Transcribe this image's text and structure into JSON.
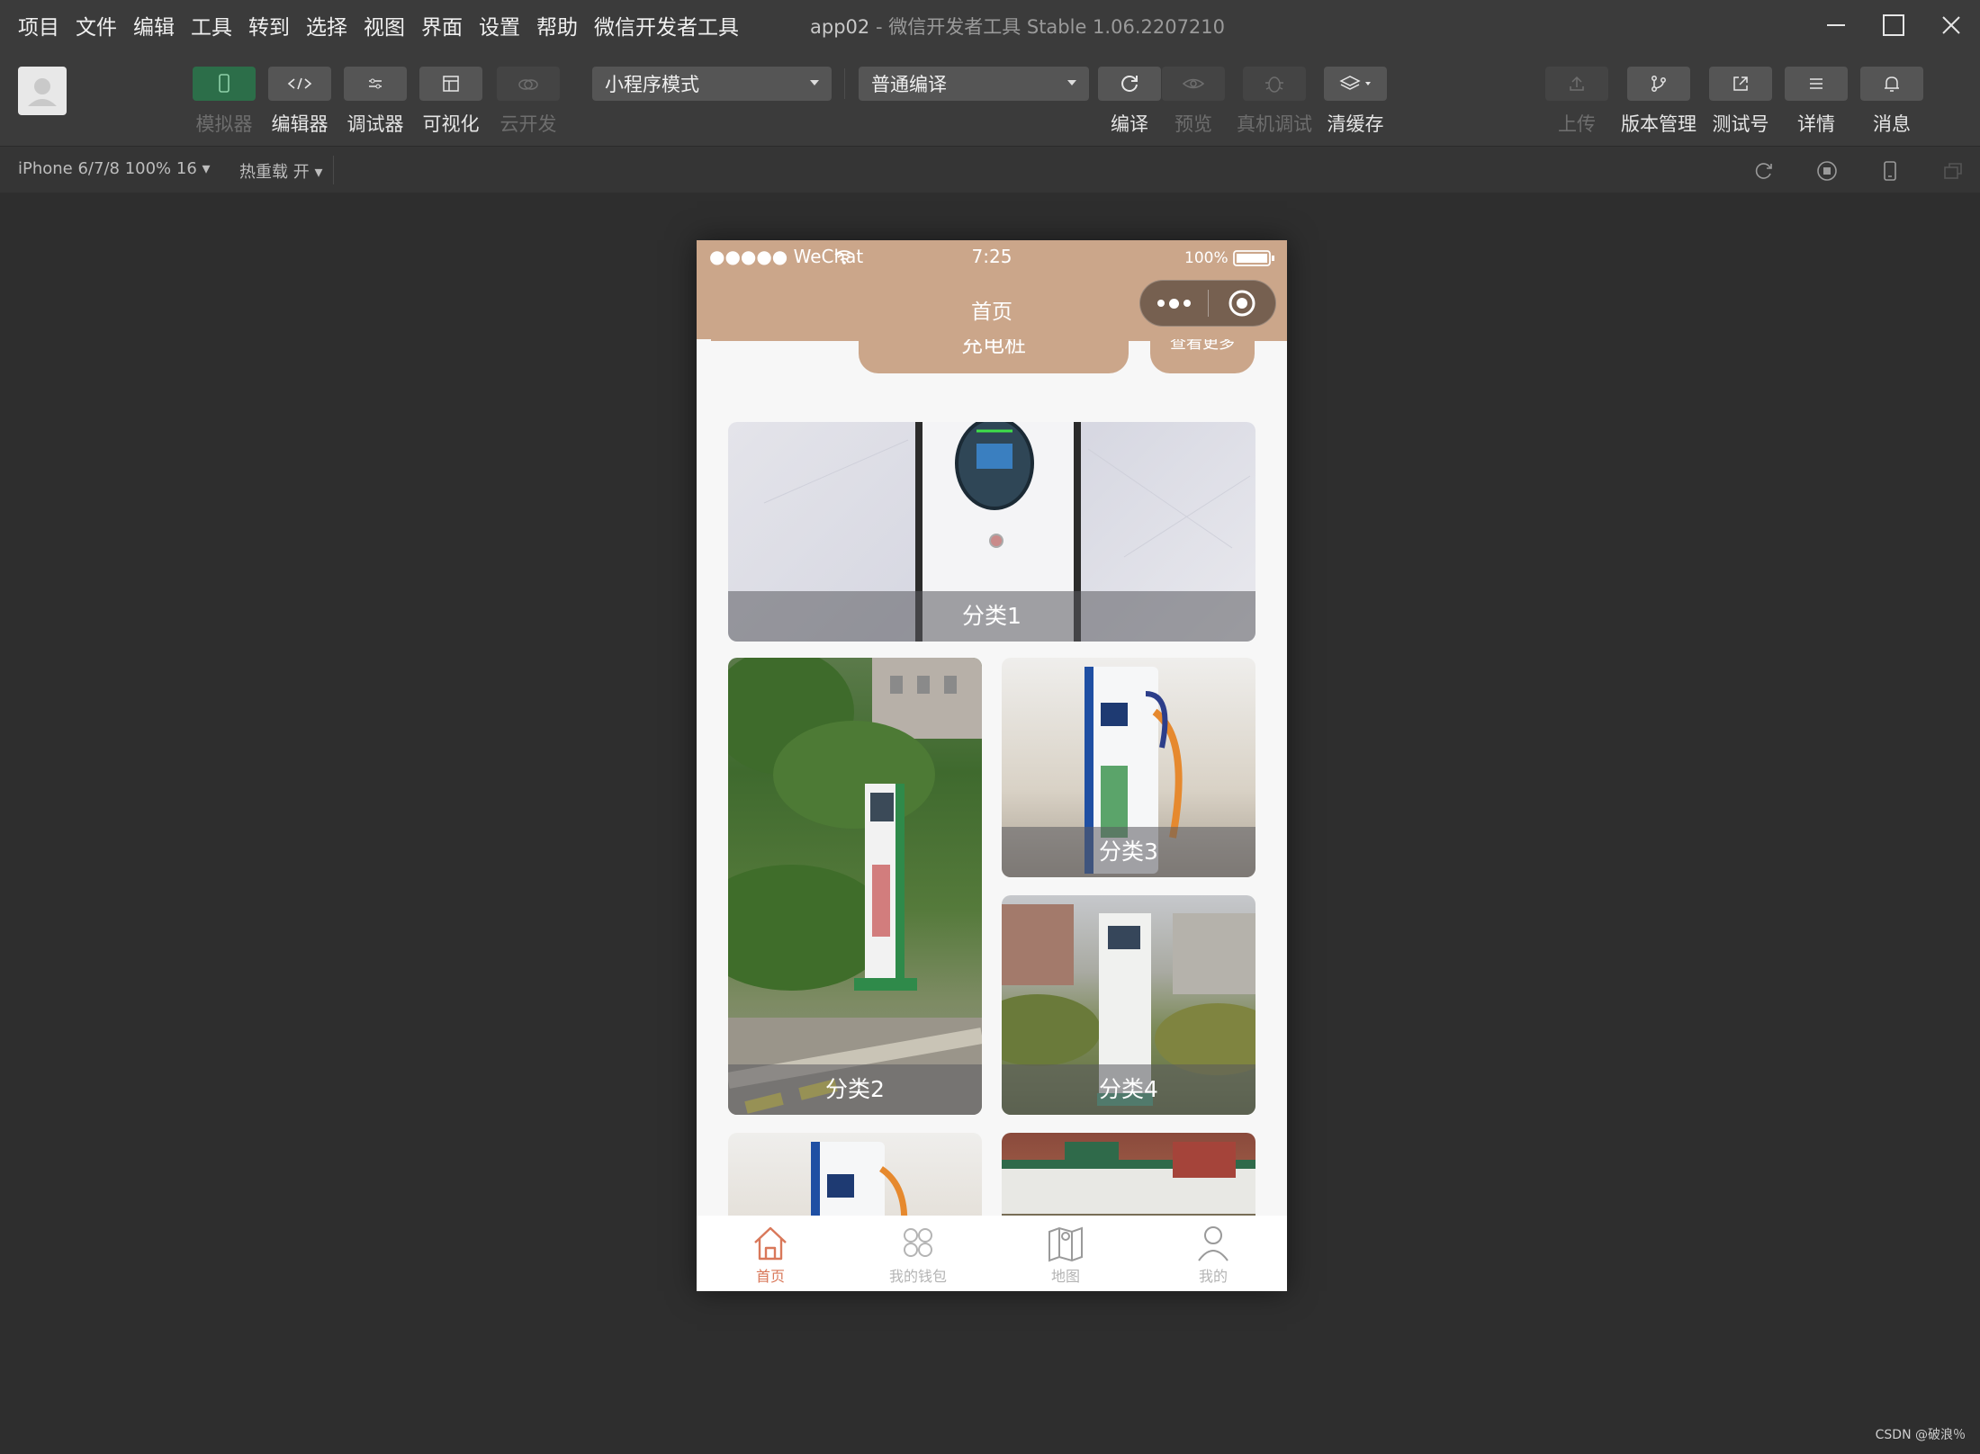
{
  "menubar": {
    "items": [
      "项目",
      "文件",
      "编辑",
      "工具",
      "转到",
      "选择",
      "视图",
      "界面",
      "设置",
      "帮助",
      "微信开发者工具"
    ],
    "app_name": "app02",
    "title_rest": " - 微信开发者工具 Stable 1.06.2207210"
  },
  "toolbar": {
    "simulator": "模拟器",
    "editor": "编辑器",
    "debugger": "调试器",
    "visual": "可视化",
    "cloud": "云开发",
    "mode_select": "小程序模式",
    "compile_select": "普通编译",
    "compile": "编译",
    "preview": "预览",
    "device_debug": "真机调试",
    "clear_cache": "清缓存",
    "upload": "上传",
    "version": "版本管理",
    "test_account": "测试号",
    "details": "详情",
    "messages": "消息"
  },
  "devbar": {
    "device": "iPhone 6/7/8 100% 16 ▾",
    "hot_reload": "热重载 开 ▾"
  },
  "phone": {
    "carrier": "●●●●● WeChat",
    "time": "7:25",
    "battery": "100%",
    "page_title": "首页",
    "pill_left": "充电桩",
    "pill_right": "查看更多",
    "categories": [
      "分类1",
      "分类2",
      "分类3",
      "分类4"
    ],
    "tabs": [
      "首页",
      "我的钱包",
      "地图",
      "我的"
    ],
    "accent": "#cba68a",
    "active_tab_color": "#d9785a"
  },
  "watermark": "CSDN @破浪％"
}
